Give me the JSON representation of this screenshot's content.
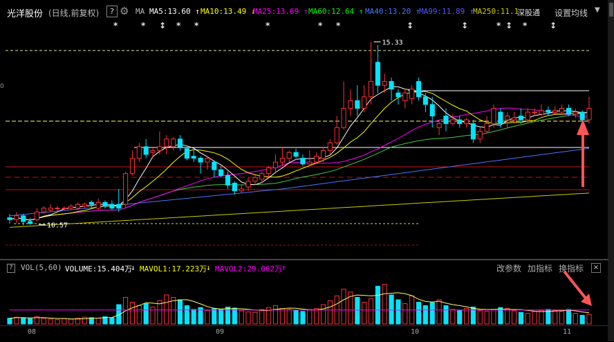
{
  "header": {
    "stock_name": "光洋股份",
    "period": "(日线,前复权)",
    "help": "?",
    "ma_label": "MA",
    "ma_items": [
      {
        "text": "MA5:13.60",
        "arrow": "↑",
        "color": "#ffffff"
      },
      {
        "text": "MA10:13.49",
        "arrow": "↓",
        "color": "#ffff00"
      },
      {
        "text": "MA25:13.69",
        "arrow": "↑",
        "color": "#ff00ff"
      },
      {
        "text": "MA60:12.64",
        "arrow": "↑",
        "color": "#00ff00"
      },
      {
        "text": "MA40:13.20",
        "arrow": "↑",
        "color": "#4477ff"
      },
      {
        "text": "MA99:11.89",
        "arrow": "↑",
        "color": "#5555ff"
      },
      {
        "text": "MA250:11.1",
        "arrow": "",
        "color": "#cccc00"
      }
    ],
    "overlay_text": "深股通",
    "settings": "设置均线"
  },
  "price_annotations": {
    "high": "15.33",
    "low": "10.57",
    "side_tick": "0"
  },
  "volume_header": {
    "help": "?",
    "indicator": "VOL(5,60)",
    "volume": "VOLUME:15.404万",
    "volume_arrow": "↓",
    "mavol1": "MAVOL1:17.223万",
    "mavol1_arrow": "↓",
    "mavol2": "MAVOL2:29.062万",
    "mavol2_arrow": "↑",
    "buttons": [
      "改参数",
      "加指标",
      "换指标"
    ],
    "close": "×"
  },
  "x_axis": {
    "months": [
      "08",
      "09",
      "10",
      "11"
    ]
  },
  "colors": {
    "up": "#ff3333",
    "down": "#00e5ff",
    "ma5": "#ffffff",
    "ma10": "#ffff00",
    "ma25": "#ff00ff",
    "ma60": "#00ff00",
    "ma40": "#4477ff",
    "ma250": "#cccc00",
    "annotation_arrow": "#ff5555"
  },
  "icons": {
    "gear": "gear-icon",
    "dropdown": "caret-down-icon",
    "annotation": "red-arrow-annotation"
  },
  "chart_data": {
    "type": "candlestick",
    "price_ylim": [
      10.2,
      15.7
    ],
    "high_label": 15.33,
    "low_label": 10.57,
    "candles": [
      [
        10.75,
        10.7,
        10.85,
        10.6
      ],
      [
        10.7,
        10.8,
        10.9,
        10.6
      ],
      [
        10.8,
        10.65,
        10.85,
        10.55
      ],
      [
        10.65,
        10.6,
        10.75,
        10.57
      ],
      [
        10.7,
        10.9,
        11.0,
        10.65
      ],
      [
        10.9,
        11.0,
        11.05,
        10.85
      ],
      [
        10.95,
        11.0,
        11.1,
        10.9
      ],
      [
        11.0,
        11.0,
        11.05,
        10.9
      ],
      [
        11.0,
        11.0,
        11.05,
        10.95
      ],
      [
        11.0,
        11.05,
        11.1,
        10.95
      ],
      [
        11.0,
        11.1,
        11.15,
        10.95
      ],
      [
        11.05,
        11.1,
        11.15,
        11.0
      ],
      [
        11.15,
        11.1,
        11.2,
        11.0
      ],
      [
        11.0,
        11.15,
        11.25,
        10.95
      ],
      [
        11.15,
        11.05,
        11.2,
        11.0
      ],
      [
        11.1,
        11.0,
        11.2,
        10.95
      ],
      [
        11.1,
        11.0,
        11.5,
        10.9
      ],
      [
        11.1,
        11.9,
        11.95,
        11.0
      ],
      [
        11.9,
        12.3,
        12.5,
        11.85
      ],
      [
        12.3,
        12.6,
        12.7,
        12.2
      ],
      [
        12.6,
        12.4,
        12.8,
        12.3
      ],
      [
        12.45,
        12.5,
        12.6,
        12.3
      ],
      [
        12.5,
        12.6,
        13.0,
        12.4
      ],
      [
        12.6,
        12.8,
        12.9,
        12.4
      ],
      [
        12.6,
        12.8,
        12.85,
        12.5
      ],
      [
        12.8,
        12.6,
        12.9,
        12.5
      ],
      [
        12.55,
        12.3,
        12.6,
        12.25
      ],
      [
        12.35,
        12.3,
        12.5,
        12.2
      ],
      [
        12.3,
        12.2,
        12.35,
        11.9
      ],
      [
        12.2,
        12.3,
        12.35,
        12.0
      ],
      [
        12.2,
        12.0,
        12.25,
        11.8
      ],
      [
        12.0,
        11.85,
        12.1,
        11.8
      ],
      [
        11.85,
        11.6,
        11.95,
        11.5
      ],
      [
        11.65,
        11.45,
        11.7,
        11.35
      ],
      [
        11.45,
        11.5,
        11.6,
        11.4
      ],
      [
        11.55,
        11.7,
        11.8,
        11.45
      ],
      [
        11.7,
        11.8,
        11.9,
        11.6
      ],
      [
        11.75,
        11.9,
        11.95,
        11.65
      ],
      [
        11.9,
        12.05,
        12.1,
        11.8
      ],
      [
        12.05,
        12.2,
        12.4,
        11.95
      ],
      [
        12.2,
        12.3,
        12.6,
        12.1
      ],
      [
        12.3,
        12.45,
        12.5,
        12.2
      ],
      [
        12.45,
        12.35,
        12.55,
        12.3
      ],
      [
        12.3,
        12.15,
        12.4,
        12.1
      ],
      [
        12.15,
        12.2,
        12.5,
        12.1
      ],
      [
        12.2,
        12.35,
        12.45,
        12.15
      ],
      [
        12.3,
        12.5,
        12.6,
        12.2
      ],
      [
        12.5,
        12.7,
        12.8,
        12.4
      ],
      [
        12.7,
        13.1,
        13.4,
        12.65
      ],
      [
        13.1,
        13.6,
        14.3,
        13.05
      ],
      [
        13.6,
        13.8,
        14.1,
        13.4
      ],
      [
        13.8,
        13.6,
        14.2,
        13.4
      ],
      [
        13.6,
        13.9,
        14.2,
        13.5
      ],
      [
        13.9,
        14.3,
        15.33,
        13.7
      ],
      [
        14.8,
        14.2,
        15.25,
        14.0
      ],
      [
        14.2,
        14.3,
        14.5,
        14.0
      ],
      [
        14.3,
        14.1,
        14.4,
        13.8
      ],
      [
        14.0,
        13.9,
        14.1,
        13.7
      ],
      [
        13.8,
        14.0,
        14.1,
        13.6
      ],
      [
        13.85,
        14.1,
        14.2,
        13.7
      ],
      [
        14.3,
        13.9,
        14.4,
        13.8
      ],
      [
        13.9,
        13.7,
        14.0,
        13.5
      ],
      [
        13.7,
        13.4,
        13.9,
        13.1
      ],
      [
        13.1,
        13.2,
        13.3,
        12.9
      ],
      [
        13.4,
        13.2,
        13.6,
        13.0
      ],
      [
        13.2,
        13.3,
        13.45,
        13.15
      ],
      [
        13.3,
        13.2,
        13.4,
        13.1
      ],
      [
        13.2,
        13.3,
        13.35,
        13.1
      ],
      [
        13.2,
        12.8,
        13.3,
        12.7
      ],
      [
        12.8,
        13.0,
        13.1,
        12.7
      ],
      [
        13.0,
        13.2,
        13.4,
        12.95
      ],
      [
        13.2,
        13.6,
        13.7,
        13.1
      ],
      [
        13.5,
        13.2,
        13.6,
        13.1
      ],
      [
        13.3,
        13.4,
        13.5,
        13.1
      ],
      [
        13.3,
        13.35,
        13.5,
        13.2
      ],
      [
        13.4,
        13.3,
        13.6,
        13.2
      ],
      [
        13.3,
        13.5,
        13.6,
        13.2
      ],
      [
        13.5,
        13.5,
        13.6,
        13.4
      ],
      [
        13.45,
        13.55,
        13.7,
        13.4
      ],
      [
        13.55,
        13.5,
        13.65,
        13.4
      ],
      [
        13.5,
        13.55,
        13.65,
        13.45
      ],
      [
        13.5,
        13.6,
        13.7,
        13.45
      ],
      [
        13.6,
        13.45,
        13.7,
        13.4
      ],
      [
        13.45,
        13.5,
        13.6,
        13.35
      ],
      [
        13.5,
        13.3,
        13.55,
        13.2
      ],
      [
        13.3,
        13.6,
        13.9,
        13.2
      ]
    ],
    "volume_ylim": [
      0,
      100
    ],
    "volumes": [
      12,
      14,
      13,
      11,
      15,
      12,
      10,
      9,
      11,
      10,
      12,
      14,
      13,
      12,
      15,
      13,
      40,
      55,
      45,
      38,
      42,
      35,
      48,
      60,
      55,
      50,
      38,
      30,
      34,
      28,
      32,
      30,
      35,
      33,
      28,
      25,
      24,
      30,
      34,
      38,
      32,
      30,
      28,
      26,
      30,
      32,
      40,
      48,
      58,
      72,
      66,
      55,
      45,
      52,
      78,
      82,
      60,
      50,
      42,
      58,
      45,
      38,
      44,
      50,
      38,
      30,
      28,
      32,
      35,
      28,
      26,
      30,
      34,
      32,
      28,
      24,
      22,
      26,
      28,
      30,
      28,
      26,
      30,
      22,
      18,
      20
    ],
    "mavol2_level": 29
  }
}
